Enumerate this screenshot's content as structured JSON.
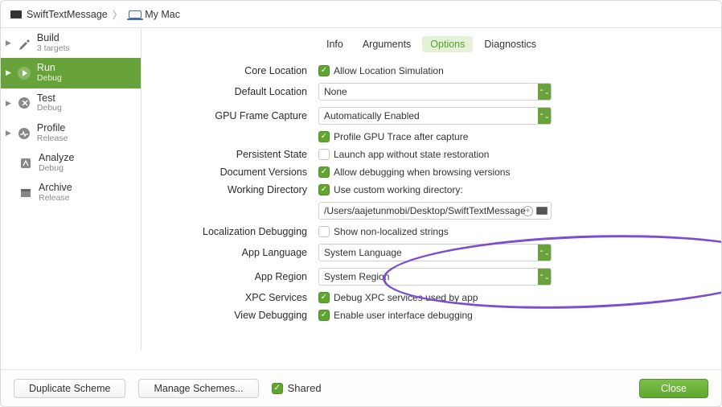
{
  "breadcrumb": {
    "project": "SwiftTextMessage",
    "target": "My Mac"
  },
  "sidebar": {
    "items": [
      {
        "title": "Build",
        "sub": "3 targets"
      },
      {
        "title": "Run",
        "sub": "Debug"
      },
      {
        "title": "Test",
        "sub": "Debug"
      },
      {
        "title": "Profile",
        "sub": "Release"
      },
      {
        "title": "Analyze",
        "sub": "Debug"
      },
      {
        "title": "Archive",
        "sub": "Release"
      }
    ]
  },
  "tabs": {
    "info": "Info",
    "arguments": "Arguments",
    "options": "Options",
    "diagnostics": "Diagnostics"
  },
  "options": {
    "core_location_label": "Core Location",
    "allow_location": "Allow Location Simulation",
    "default_location_label": "Default Location",
    "default_location_value": "None",
    "gpu_label": "GPU Frame Capture",
    "gpu_value": "Automatically Enabled",
    "profile_gpu": "Profile GPU Trace after capture",
    "persistent_label": "Persistent State",
    "persistent_text": "Launch app without state restoration",
    "docver_label": "Document Versions",
    "docver_text": "Allow debugging when browsing versions",
    "workdir_label": "Working Directory",
    "workdir_text": "Use custom working directory:",
    "workdir_path": "/Users/aajetunmobi/Desktop/SwiftTextMessage",
    "locdebug_label": "Localization Debugging",
    "locdebug_text": "Show non-localized strings",
    "applang_label": "App Language",
    "applang_value": "System Language",
    "appregion_label": "App Region",
    "appregion_value": "System Region",
    "xpc_label": "XPC Services",
    "xpc_text": "Debug XPC services used by app",
    "viewdbg_label": "View Debugging",
    "viewdbg_text": "Enable user interface debugging"
  },
  "footer": {
    "duplicate": "Duplicate Scheme",
    "manage": "Manage Schemes...",
    "shared": "Shared",
    "close": "Close"
  }
}
